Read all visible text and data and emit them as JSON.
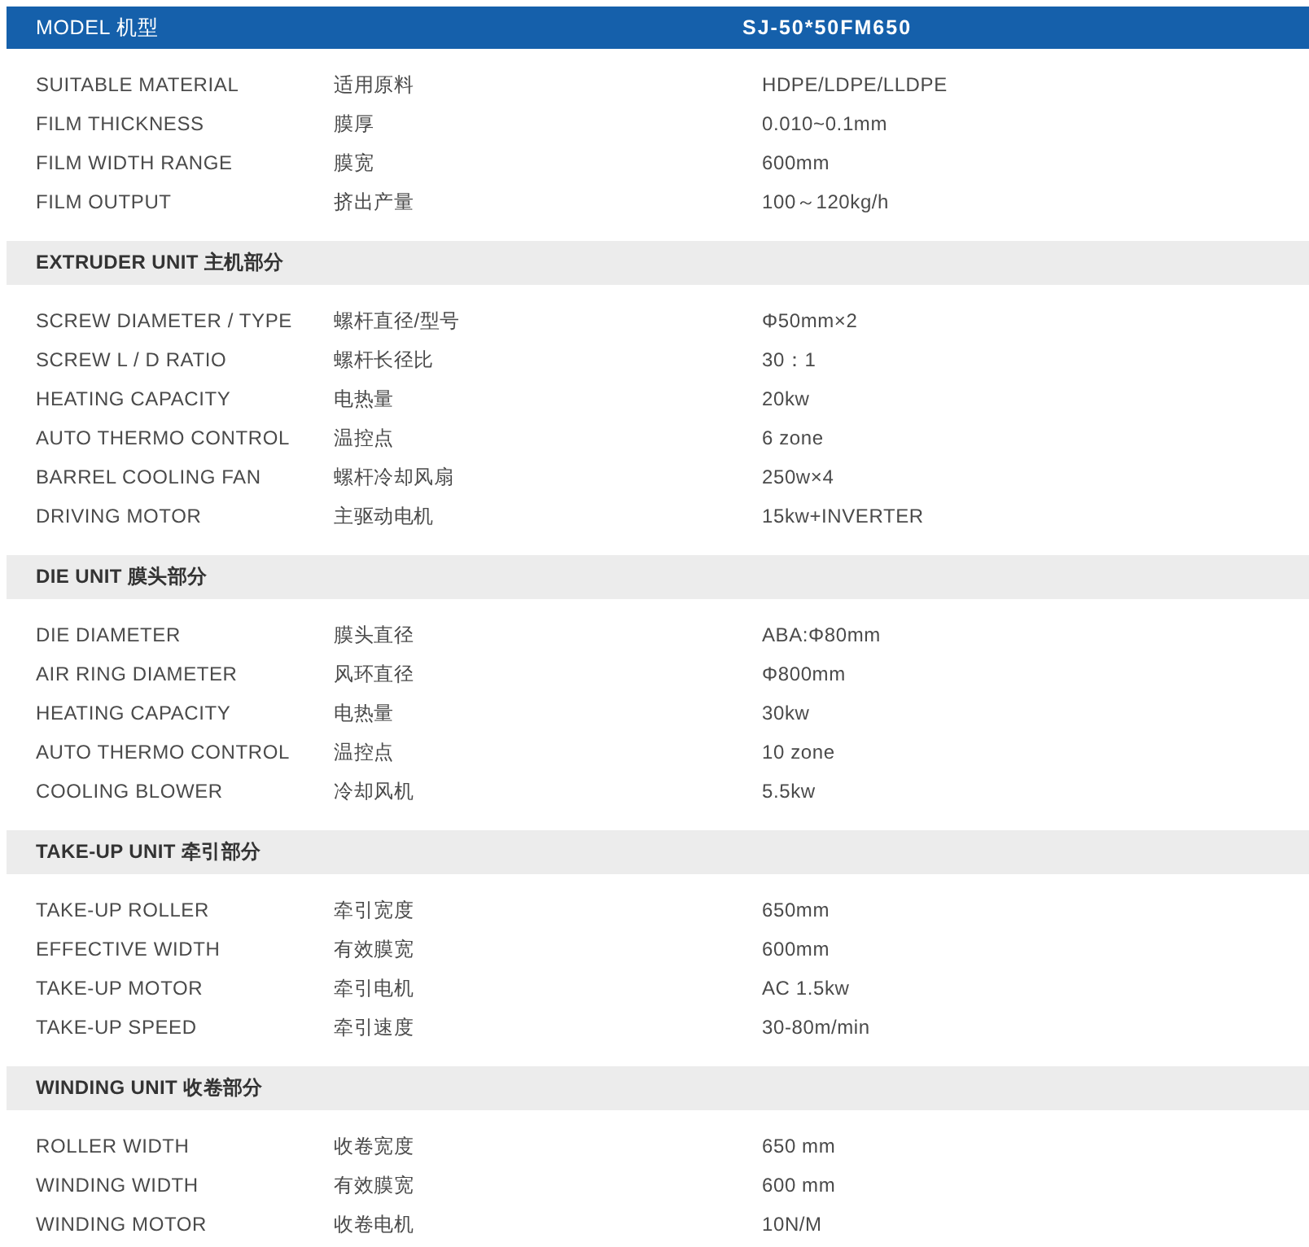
{
  "header": {
    "label": "MODEL 机型",
    "value": "SJ-50*50FM650"
  },
  "sections": [
    {
      "rows": [
        {
          "en": "SUITABLE MATERIAL",
          "zh": "适用原料",
          "value": "HDPE/LDPE/LLDPE"
        },
        {
          "en": "FILM THICKNESS",
          "zh": "膜厚",
          "value": "0.010~0.1mm"
        },
        {
          "en": "FILM WIDTH RANGE",
          "zh": "膜宽",
          "value": "600mm"
        },
        {
          "en": "FILM OUTPUT",
          "zh": "挤出产量",
          "value": "100～120kg/h"
        }
      ]
    },
    {
      "title": "EXTRUDER UNIT 主机部分",
      "rows": [
        {
          "en": "SCREW DIAMETER / TYPE",
          "zh": "螺杆直径/型号",
          "value": "Φ50mm×2"
        },
        {
          "en": "SCREW L / D RATIO",
          "zh": "螺杆长径比",
          "value": "30：1"
        },
        {
          "en": "HEATING CAPACITY",
          "zh": "电热量",
          "value": "20kw"
        },
        {
          "en": "AUTO THERMO CONTROL",
          "zh": "温控点",
          "value": "6 zone"
        },
        {
          "en": "BARREL COOLING FAN",
          "zh": "螺杆冷却风扇",
          "value": "250w×4"
        },
        {
          "en": "DRIVING MOTOR",
          "zh": "主驱动电机",
          "value": "15kw+INVERTER"
        }
      ]
    },
    {
      "title": "DIE UNIT 膜头部分",
      "rows": [
        {
          "en": "DIE DIAMETER",
          "zh": "膜头直径",
          "value": "ABA:Φ80mm"
        },
        {
          "en": "AIR RING DIAMETER",
          "zh": "风环直径",
          "value": "Φ800mm"
        },
        {
          "en": "HEATING CAPACITY",
          "zh": "电热量",
          "value": "30kw"
        },
        {
          "en": "AUTO THERMO CONTROL",
          "zh": "温控点",
          "value": "10 zone"
        },
        {
          "en": "COOLING BLOWER",
          "zh": "冷却风机",
          "value": "5.5kw"
        }
      ]
    },
    {
      "title": "TAKE-UP UNIT 牵引部分",
      "rows": [
        {
          "en": "TAKE-UP ROLLER",
          "zh": "牵引宽度",
          "value": "650mm"
        },
        {
          "en": "EFFECTIVE WIDTH",
          "zh": "有效膜宽",
          "value": "600mm"
        },
        {
          "en": "TAKE-UP MOTOR",
          "zh": "牵引电机",
          "value": "AC 1.5kw"
        },
        {
          "en": "TAKE-UP SPEED",
          "zh": "牵引速度",
          "value": "30-80m/min"
        }
      ]
    },
    {
      "title": "WINDING UNIT 收卷部分",
      "rows": [
        {
          "en": "ROLLER WIDTH",
          "zh": "收卷宽度",
          "value": "650 mm"
        },
        {
          "en": "WINDING WIDTH",
          "zh": "有效膜宽",
          "value": "600 mm"
        },
        {
          "en": "WINDING MOTOR",
          "zh": "收卷电机",
          "value": "10N/M"
        }
      ]
    }
  ]
}
